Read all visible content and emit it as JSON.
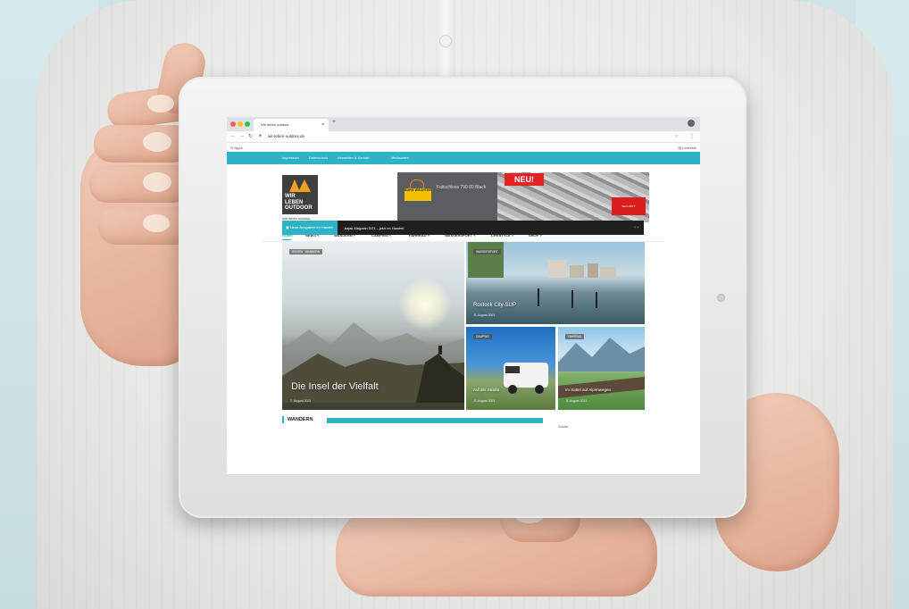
{
  "browser": {
    "tab_title": "Wir leben outdoor",
    "tab_close": "×",
    "new_tab": "+",
    "url": "wir-leben-outdoor.de",
    "bookmarks_apps": "Apps",
    "reading_list": "Leseliste"
  },
  "site": {
    "top_links": [
      "Impressum",
      "Datenschutz",
      "Newsletter & Kontakt",
      "Mediadaten"
    ],
    "logo_lines": [
      "WIR",
      "LEBEN",
      "OUTDOOR"
    ],
    "logo_sub": "Wir leben outdoor",
    "ad": {
      "brand": "BURG WÄCHTER",
      "product": "Faltschloss 790 80 Black",
      "badge": "NEU!",
      "security": "SECURITY"
    },
    "nav": [
      "HOME",
      "NEWS ˅",
      "WANDERN ˅",
      "CAMPING ˅",
      "FAHRRAD ˅",
      "WASSERSPORT ˅",
      "LIFESTYLE ˅",
      "SHOP ˅"
    ],
    "ticker": {
      "label": "Neue Ausgaben im Handel",
      "text": "kajak Magazin 5/21 – jetzt im Handel!",
      "arrows": "‹  ›"
    },
    "cards": [
      {
        "category": "REISEN · WANDERN",
        "title": "Die Insel der Vielfalt",
        "date": "7. August 2021"
      },
      {
        "category": "WASSERSPORT",
        "title": "Rostock City-SUP",
        "date": "8. August 2021"
      },
      {
        "category": "CAMPING",
        "title": "Auf der Straße",
        "date": "8. August 2021"
      },
      {
        "category": "FAHRRAD",
        "title": "Im Sattel auf Alpenwegen",
        "date": "8. August 2021"
      }
    ],
    "section": "WANDERN",
    "search": "Suche"
  },
  "colors": {
    "accent": "#2eb3c6",
    "ticker_bg": "#1f1f1f",
    "ad_red": "#e02424"
  }
}
